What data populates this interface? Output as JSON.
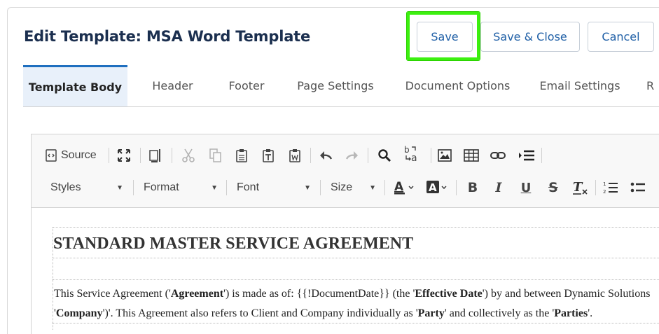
{
  "header": {
    "title": "Edit Template: MSA Word Template",
    "save_label": "Save",
    "save_close_label": "Save & Close",
    "cancel_label": "Cancel",
    "highlight_color": "#3cf010"
  },
  "tabs": [
    {
      "label": "Template Body",
      "active": true
    },
    {
      "label": "Header"
    },
    {
      "label": "Footer"
    },
    {
      "label": "Page Settings"
    },
    {
      "label": "Document Options"
    },
    {
      "label": "Email Settings"
    },
    {
      "label": "R"
    }
  ],
  "toolbar": {
    "source_label": "Source",
    "styles_label": "Styles",
    "format_label": "Format",
    "font_label": "Font",
    "size_label": "Size",
    "icons": [
      "source-icon",
      "maximize-icon",
      "show-blocks-icon",
      "cut-icon",
      "copy-icon",
      "paste-icon",
      "paste-text-icon",
      "paste-word-icon",
      "undo-icon",
      "redo-icon",
      "find-icon",
      "replace-icon",
      "image-icon",
      "table-icon",
      "link-icon",
      "page-break-icon",
      "text-color-icon",
      "background-color-icon",
      "bold-icon",
      "italic-icon",
      "underline-icon",
      "strikethrough-icon",
      "remove-format-icon",
      "numbered-list-icon",
      "bulleted-list-icon"
    ]
  },
  "document": {
    "heading": "STANDARD MASTER SERVICE AGREEMENT",
    "p1_a": "This Service Agreement ('",
    "p1_b": "Agreement",
    "p1_c": "') is made as of: {{!DocumentDate}} (the '",
    "p1_d": "Effective Date",
    "p1_e": "') by and between Dynamic Solutions",
    "p2_a": "'",
    "p2_b": "Company",
    "p2_c": "')'. This Agreement also refers to Client and Company individually as '",
    "p2_d": "Party",
    "p2_e": "' and collectively as the '",
    "p2_f": "Parties",
    "p2_g": "'."
  }
}
